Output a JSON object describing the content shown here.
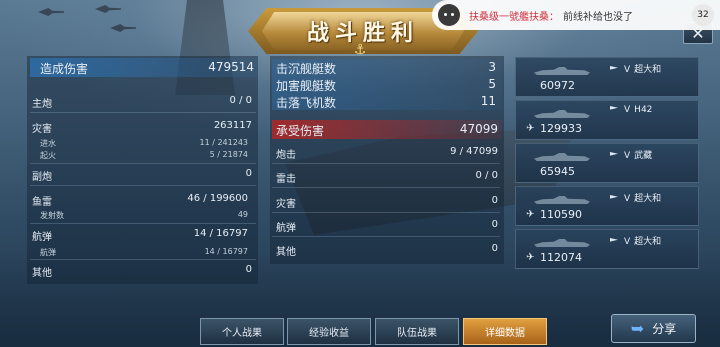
{
  "banner": {
    "title": "战斗胜利"
  },
  "notification": {
    "sender": "扶桑级一號艦扶桑",
    "message": "前线补给也没了",
    "count": "32"
  },
  "left": {
    "damage_label": "造成伤害",
    "damage_value": "479514",
    "main_gun_label": "主炮",
    "main_gun_value": "0 / 0",
    "disaster_label": "灾害",
    "disaster_value": "263117",
    "flood_label": "进水",
    "flood_value": "11 / 241243",
    "fire_label": "起火",
    "fire_value": "5 / 21874",
    "secondary_label": "副炮",
    "secondary_value": "0",
    "torpedo_label": "鱼雷",
    "torpedo_value": "46 / 199600",
    "launch_label": "发射数",
    "launch_value": "49",
    "aviation_label": "航弹",
    "aviation_value": "14 / 16797",
    "aviation_sub_label": "航弹",
    "aviation_sub_value": "14 / 16797",
    "other_label": "其他",
    "other_value": "0"
  },
  "middle": {
    "sunk_label": "击沉舰艇数",
    "sunk_value": "3",
    "damaged_label": "加害舰艇数",
    "damaged_value": "5",
    "planes_label": "击落飞机数",
    "planes_value": "11",
    "received_label": "承受伤害",
    "received_value": "47099",
    "shell_label": "炮击",
    "shell_value": "9 / 47099",
    "torp_label": "雷击",
    "torp_value": "0 / 0",
    "disaster_label": "灾害",
    "disaster_value": "0",
    "bomb_label": "航弹",
    "bomb_value": "0",
    "other_label": "其他",
    "other_value": "0"
  },
  "ships": [
    {
      "rank": "V",
      "name": "超大和",
      "value": "60972",
      "icon": "ship-icon"
    },
    {
      "rank": "V",
      "name": "H42",
      "value": "129933",
      "icon": "plane-icon"
    },
    {
      "rank": "V",
      "name": "武藏",
      "value": "65945",
      "icon": "ship-icon"
    },
    {
      "rank": "V",
      "name": "超大和",
      "value": "110590",
      "icon": "plane-icon"
    },
    {
      "rank": "V",
      "name": "超大和",
      "value": "112074",
      "icon": "plane-icon"
    }
  ],
  "tabs": [
    {
      "label": "个人战果"
    },
    {
      "label": "经验收益"
    },
    {
      "label": "队伍战果"
    },
    {
      "label": "详细数据"
    }
  ],
  "share": {
    "label": "分享"
  },
  "colors": {
    "accent_gold": "#e1a040",
    "highlight_blue": "#2e6eaa",
    "highlight_red": "#aa2828"
  }
}
